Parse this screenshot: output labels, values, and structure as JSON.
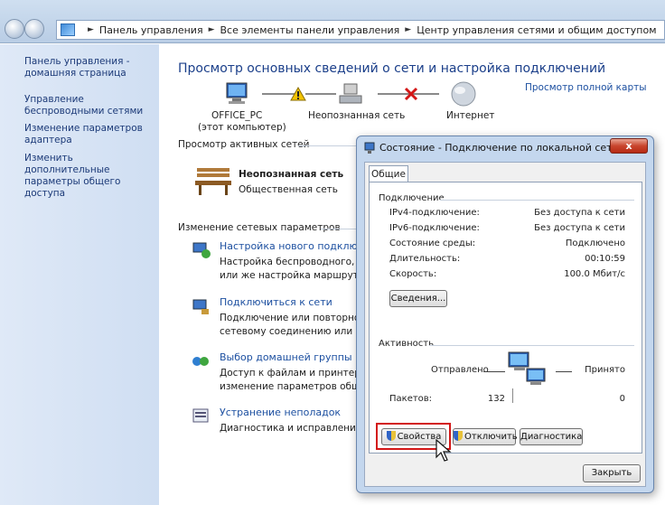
{
  "breadcrumb": [
    "Панель управления",
    "Все элементы панели управления",
    "Центр управления сетями и общим доступом"
  ],
  "sidebar": {
    "items": [
      {
        "label": "Панель управления - домашняя страница"
      },
      {
        "label": "Управление беспроводными сетями"
      },
      {
        "label": "Изменение параметров адаптера"
      },
      {
        "label": "Изменить дополнительные параметры общего доступа"
      }
    ]
  },
  "main": {
    "title": "Просмотр основных сведений о сети и настройка подключений",
    "full_map_link": "Просмотр полной карты",
    "map": {
      "computer_name": "OFFICE_PC",
      "computer_sub": "(этот компьютер)",
      "network": "Неопознанная сеть",
      "internet": "Интернет"
    },
    "active_networks_heading": "Просмотр активных сетей",
    "active_network": {
      "name": "Неопознанная сеть",
      "type": "Общественная сеть"
    },
    "change_settings_heading": "Изменение сетевых параметров",
    "tasks": [
      {
        "link": "Настройка нового подключения",
        "desc": [
          "Настройка беспроводного, шир",
          "или же настройка маршрутиза"
        ]
      },
      {
        "link": "Подключиться к сети",
        "desc": [
          "Подключение или повторное п",
          "сетевому соединению или под"
        ]
      },
      {
        "link": "Выбор домашней группы и пар",
        "desc": [
          "Доступ к файлам и принтерам,",
          "изменение параметров общего"
        ]
      },
      {
        "link": "Устранение неполадок",
        "desc": [
          "Диагностика и исправление сет"
        ]
      }
    ]
  },
  "dialog": {
    "title": "Состояние - Подключение по локальной сети",
    "close_label": "x",
    "tab": "Общие",
    "connection_group": "Подключение",
    "rows": [
      {
        "label": "IPv4-подключение:",
        "value": "Без доступа к сети"
      },
      {
        "label": "IPv6-подключение:",
        "value": "Без доступа к сети"
      },
      {
        "label": "Состояние среды:",
        "value": "Подключено"
      },
      {
        "label": "Длительность:",
        "value": "00:10:59"
      },
      {
        "label": "Скорость:",
        "value": "100.0 Мбит/с"
      }
    ],
    "details_button": "Сведения...",
    "activity_group": "Активность",
    "sent_label": "Отправлено",
    "received_label": "Принято",
    "packets_label": "Пакетов:",
    "packets_sent": "132",
    "packets_received": "0",
    "properties_button": "Свойства",
    "disable_button": "Отключить",
    "diagnose_button": "Диагностика",
    "close_button": "Закрыть"
  },
  "colors": {
    "link": "#1c4fa0",
    "title": "#1b3f8a",
    "highlight": "#d31717"
  }
}
